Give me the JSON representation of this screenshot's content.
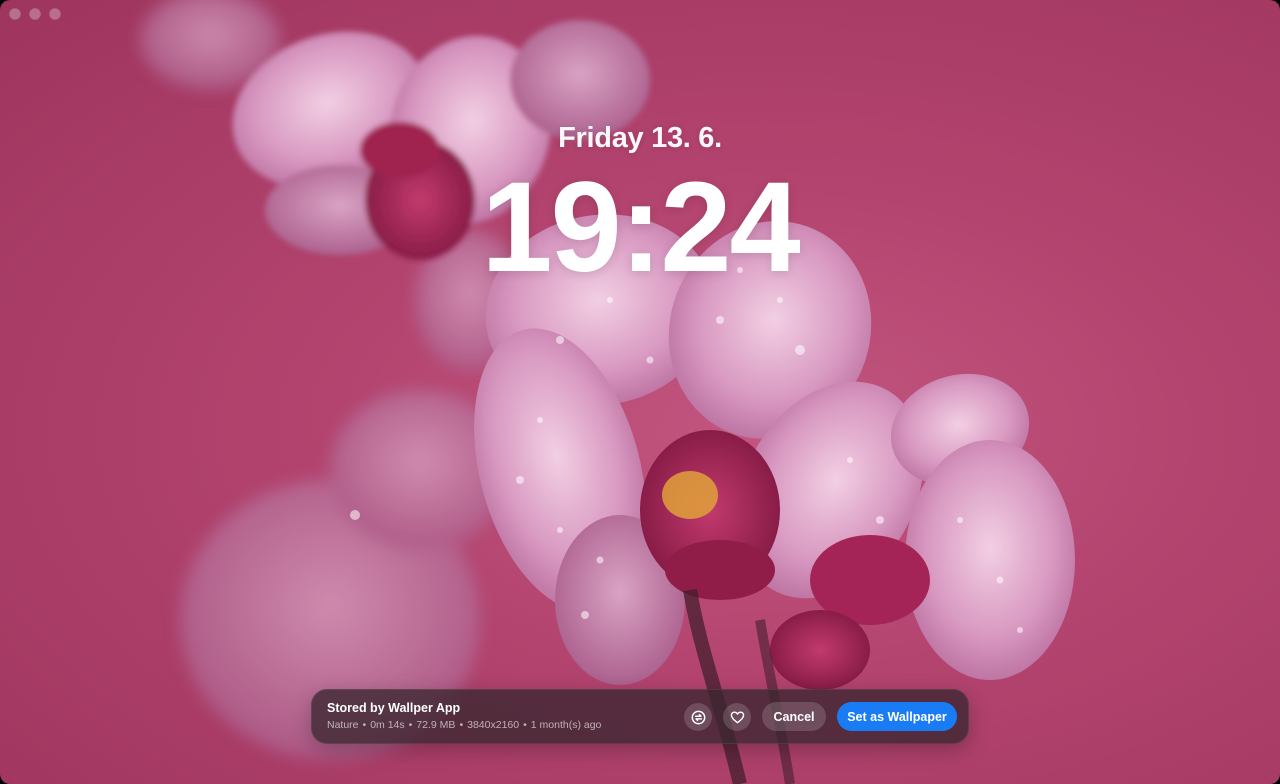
{
  "window": {
    "title": ""
  },
  "lockscreen": {
    "date": "Friday 13. 6.",
    "time": "19:24"
  },
  "wallpaper_panel": {
    "source": "Stored by Wallper App",
    "category": "Nature",
    "duration": "0m 14s",
    "file_size": "72.9 MB",
    "resolution": "3840x2160",
    "age": "1 month(s) ago",
    "separator": "•",
    "refresh_icon": "refresh-icon",
    "favorite_icon": "heart-icon",
    "cancel_label": "Cancel",
    "set_label": "Set as Wallpaper"
  },
  "colors": {
    "background": "#b3446f",
    "accent": "#1a7cf5",
    "panel": "#3a2630"
  }
}
